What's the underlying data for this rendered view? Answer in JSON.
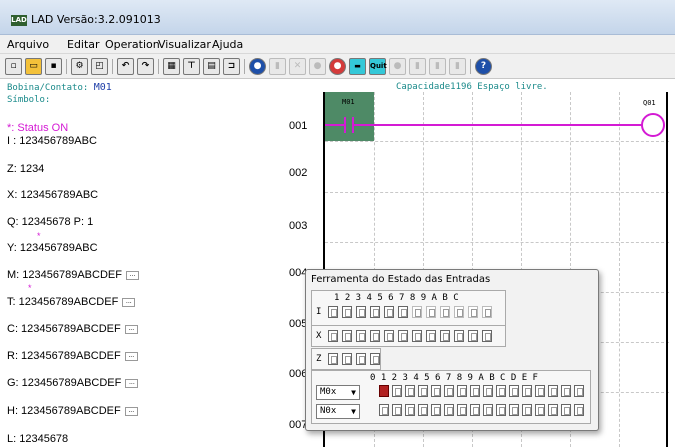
{
  "window": {
    "title": "LAD Versão:3.2.091013"
  },
  "menu": [
    "Arquivo",
    "Editar",
    "Operation",
    "Visualizar",
    "Ajuda"
  ],
  "status": {
    "bobina_label": "Bobina/Contato:",
    "bobina_value": "M01",
    "capacity": "Capacidade1196 Espaço livre.",
    "simbolo": "Símbolo:"
  },
  "left": [
    {
      "label": "*: Status ON"
    },
    {
      "label": "I : 123456789ABC"
    },
    {
      "label": "Z: 1234"
    },
    {
      "label": "X: 123456789ABC"
    },
    {
      "label": "Q: 12345678  P: 1"
    },
    {
      "label": "Y: 123456789ABC"
    },
    {
      "label": "M: 123456789ABCDEF"
    },
    {
      "label": "T: 123456789ABCDEF"
    },
    {
      "label": "C: 123456789ABCDEF"
    },
    {
      "label": "R: 123456789ABCDEF"
    },
    {
      "label": "G: 123456789ABCDEF"
    },
    {
      "label": "H: 123456789ABCDEF"
    },
    {
      "label": "L: 12345678"
    }
  ],
  "rows": [
    "001",
    "002",
    "003",
    "004",
    "005",
    "006",
    "007"
  ],
  "ladder": {
    "contact": "M01",
    "coil": "Q01"
  },
  "dialog": {
    "title": "Ferramenta do Estado das Entradas",
    "i_header": "1 2 3 4 5 6 7 8 9 A B C",
    "i_label": "I",
    "x_label": "X",
    "z_label": "Z",
    "m_header": "0 1 2 3 4 5 6 7 8 9 A B C D E F",
    "select1": "M0x",
    "select2": "N0x"
  }
}
